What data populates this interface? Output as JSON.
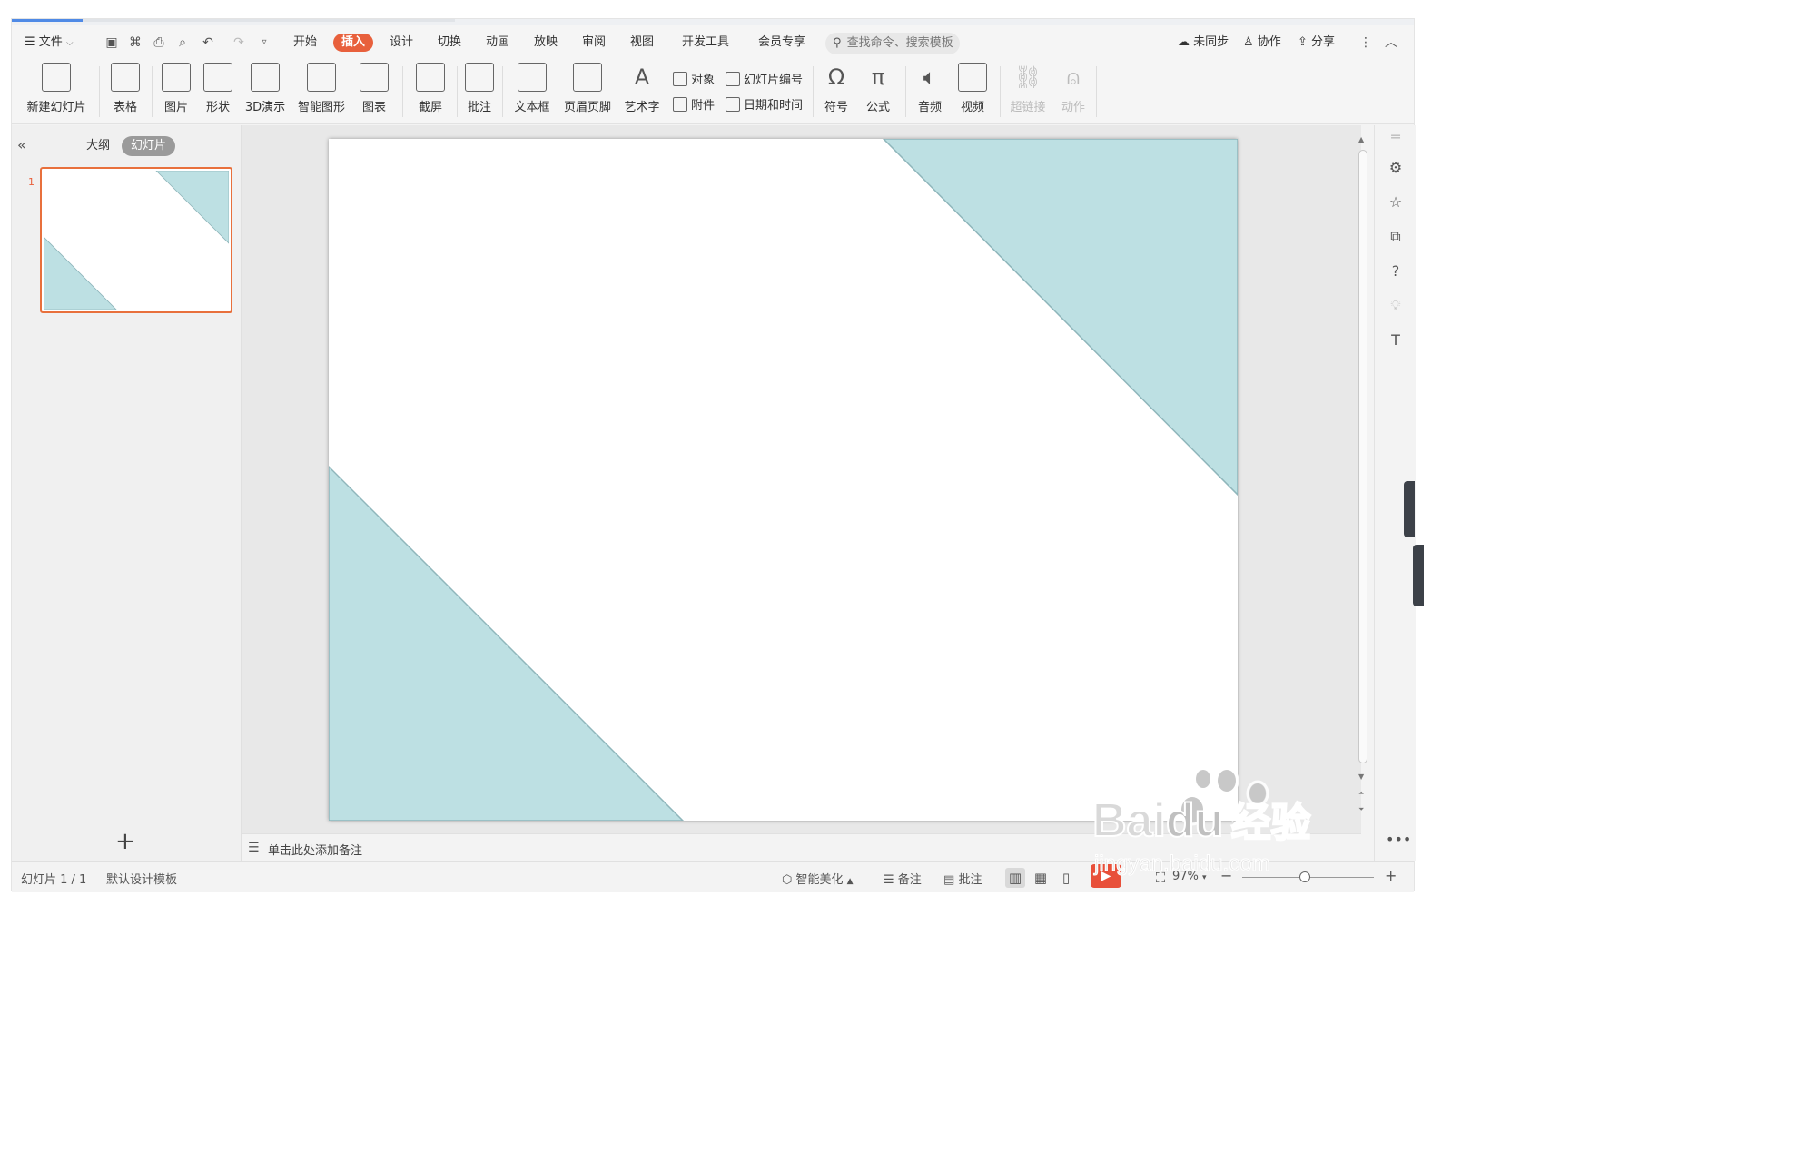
{
  "menu": {
    "file": "文件",
    "tabs": [
      "开始",
      "插入",
      "设计",
      "切换",
      "动画",
      "放映",
      "审阅",
      "视图",
      "开发工具",
      "会员专享"
    ],
    "active_tab": "插入",
    "search_placeholder": "查找命令、搜索模板",
    "sync": "未同步",
    "collab": "协作",
    "share": "分享"
  },
  "ribbon": {
    "new_slide": "新建幻灯片",
    "table": "表格",
    "picture": "图片",
    "shape": "形状",
    "demo3d": "3D演示",
    "smartart": "智能图形",
    "chart": "图表",
    "screenshot": "截屏",
    "comment": "批注",
    "textbox": "文本框",
    "header_footer": "页眉页脚",
    "wordart": "艺术字",
    "object": "对象",
    "attachment": "附件",
    "slide_number": "幻灯片编号",
    "datetime": "日期和时间",
    "symbol": "符号",
    "formula": "公式",
    "audio": "音频",
    "video": "视频",
    "hyperlink": "超链接",
    "action": "动作"
  },
  "panel": {
    "tab_outline": "大纲",
    "tab_slides": "幻灯片",
    "slide_number": "1"
  },
  "slide": {
    "accent_color": "#bde0e3",
    "edge_color": "#8fb6bb"
  },
  "notes": {
    "placeholder": "单击此处添加备注"
  },
  "status": {
    "slide_info": "幻灯片 1 / 1",
    "template": "默认设计模板",
    "beautify": "智能美化",
    "notes": "备注",
    "comment": "批注",
    "zoom": "97%"
  },
  "watermark": {
    "brand": "Bai",
    "brand2": "du",
    "cn": "经验",
    "url": "jingyan.baidu.com"
  }
}
